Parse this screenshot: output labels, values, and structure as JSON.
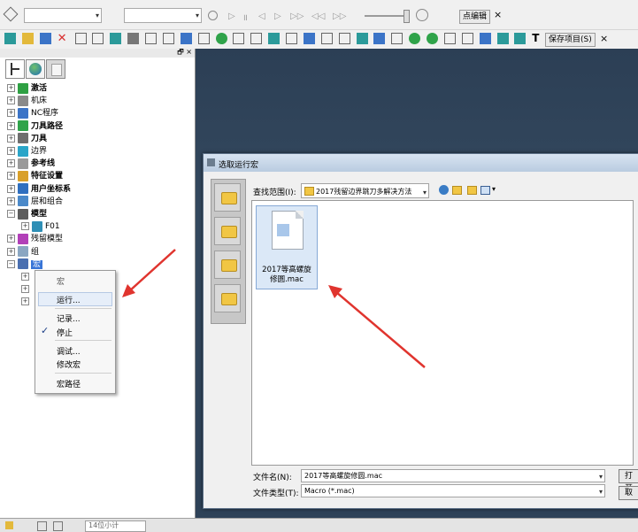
{
  "toolbar": {
    "macro_edit_label": "点编辑",
    "save_project_label": "保存项目(S)",
    "close_glyph": "×"
  },
  "explorer": {
    "panel_glyph": "🗗 ×",
    "tree": [
      {
        "label": "激活",
        "bold": true,
        "icon_color": "#2ea043"
      },
      {
        "label": "机床",
        "bold": false,
        "icon_color": "#8a8a8a"
      },
      {
        "label": "NC程序",
        "bold": false,
        "icon_color": "#3b74c7"
      },
      {
        "label": "刀具路径",
        "bold": true,
        "icon_color": "#2fa34a"
      },
      {
        "label": "刀具",
        "bold": true,
        "icon_color": "#6e6e6e"
      },
      {
        "label": "边界",
        "bold": false,
        "icon_color": "#2aa5c8"
      },
      {
        "label": "参考线",
        "bold": true,
        "icon_color": "#9a9a9a"
      },
      {
        "label": "特征设置",
        "bold": true,
        "icon_color": "#d9a02a"
      },
      {
        "label": "用户坐标系",
        "bold": true,
        "icon_color": "#2f6fbf"
      },
      {
        "label": "层和组合",
        "bold": false,
        "icon_color": "#4b89c9"
      },
      {
        "label": "模型",
        "bold": true,
        "icon_color": "#5c5c5c"
      },
      {
        "label": "F01",
        "bold": false,
        "icon_color": "#2f8fb6",
        "child": true
      },
      {
        "label": "残留模型",
        "bold": false,
        "icon_color": "#b240b8"
      },
      {
        "label": "组",
        "bold": false,
        "icon_color": "#8aa6c2"
      },
      {
        "label": "宏",
        "bold": false,
        "icon_color": "#4a6fb0",
        "selected": true
      }
    ]
  },
  "context_menu": {
    "header": "宏",
    "items": [
      "运行...",
      "记录...",
      "停止",
      "调试...",
      "修改宏",
      "宏路径"
    ],
    "check": "✓"
  },
  "dialog": {
    "title": "选取运行宏",
    "look_in_label": "查找范围(I):",
    "look_in_value": "2017残留边界跳刀多解决方法",
    "file_name_caption": "2017等高螺旋修圆.mac",
    "file_name_label": "文件名(N):",
    "file_name_value": "2017等高螺旋修圆.mac",
    "file_type_label": "文件类型(T):",
    "file_type_value": "Macro (*.mac)",
    "open_button": "打开",
    "cancel_button": "取"
  },
  "status": {
    "field_text": "14位小计"
  }
}
